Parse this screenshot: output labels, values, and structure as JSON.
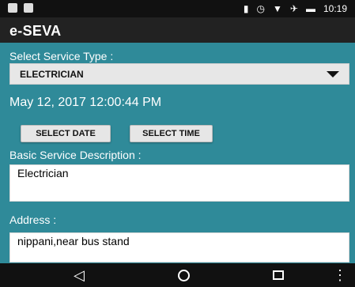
{
  "status_bar": {
    "time": "10:19",
    "icons": [
      "notification-icon",
      "image-icon",
      "vibrate-icon",
      "alarm-icon",
      "wifi-icon",
      "airplane-icon",
      "battery-icon"
    ]
  },
  "app": {
    "title": "e-SEVA"
  },
  "form": {
    "select_service_label": "Select Service Type :",
    "service_selected": "ELECTRICIAN",
    "date_time": "May 12, 2017 12:00:44 PM",
    "select_date_label": "SELECT DATE",
    "select_time_label": "SELECT TIME",
    "description_label": "Basic Service Description :",
    "description_value": "Electrician",
    "address_label": "Address :",
    "address_value": "nippani,near bus stand"
  },
  "nav": {
    "back_glyph": "◁",
    "more_glyph": "⋮"
  },
  "colors": {
    "background": "#2f8a99",
    "app_bar": "#222222"
  }
}
